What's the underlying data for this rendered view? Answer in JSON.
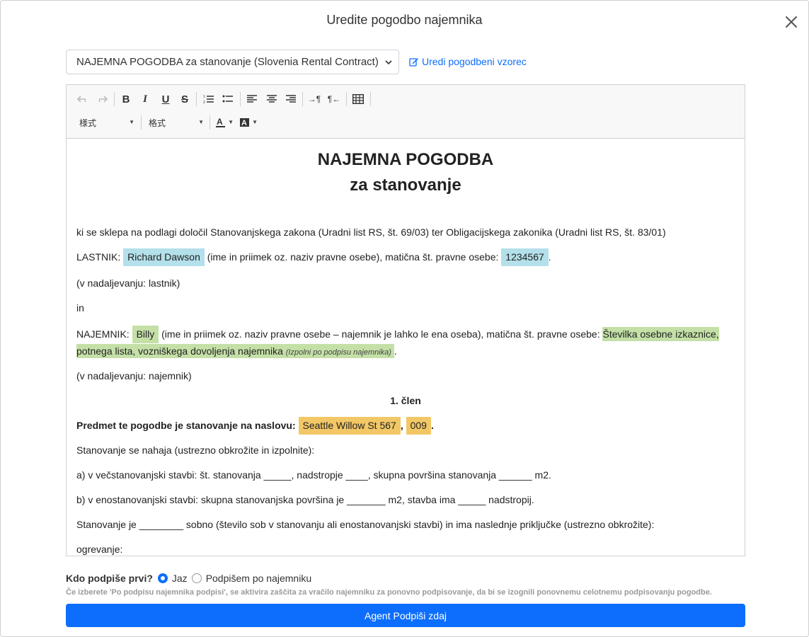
{
  "modal": {
    "title": "Uredite pogodbo najemnika"
  },
  "template": {
    "selected": "NAJEMNA POGODBA za stanovanje (Slovenia Rental Contract)",
    "edit_link": "Uredi pogodbeni vzorec"
  },
  "toolbar": {
    "style_label": "様式",
    "format_label": "格式",
    "buttons": [
      "undo",
      "redo",
      "bold",
      "italic",
      "underline",
      "strikethrough",
      "numbered-list",
      "bulleted-list",
      "align-left",
      "align-center",
      "align-right",
      "ltr",
      "rtl",
      "table",
      "text-color",
      "background-color"
    ]
  },
  "document": {
    "title_line1": "NAJEMNA POGODBA",
    "title_line2": "za stanovanje",
    "intro": "ki se sklepa na podlagi določil Stanovanjskega zakona (Uradni list RS, št. 69/03) ter Obligacijskega zakonika (Uradni list RS, št. 83/01)",
    "owner_prefix": "LASTNIK:",
    "owner_name": "Richard Dawson",
    "owner_mid": "(ime in priimek oz. naziv pravne osebe), matična št. pravne osebe:",
    "owner_id": "1234567",
    "owner_after": ".",
    "owner_note": "(v nadaljevanju: lastnik)",
    "and": "in",
    "tenant_prefix": "NAJEMNIK:",
    "tenant_name": "Billy",
    "tenant_mid": "(ime in priimek oz. naziv pravne osebe – najemnik je lahko le ena oseba), matična št. pravne osebe:",
    "tenant_id": "Številka osebne izkaznice, potnega lista, vozniškega dovoljenja najemnika",
    "tenant_id_hint": "(Izpolni po podpisu najemnika)",
    "tenant_after": ".",
    "tenant_note": "(v nadaljevanju: najemnik)",
    "article1": "1. člen",
    "subject_label": "Predmet te pogodbe je stanovanje na naslovu:",
    "address": "Seattle Willow St 567",
    "address_sep": ",",
    "unit": "009",
    "subject_after": ".",
    "located": "Stanovanje se nahaja (ustrezno obkrožite in izpolnite):",
    "option_a": "a) v večstanovanjski stavbi: št. stanovanja _____, nadstropje ____, skupna površina stanovanja ______ m2.",
    "option_b": "b) v enostanovanjski stavbi: skupna stanovanjska površina je _______ m2, stavba ima _____ nadstropij.",
    "rooms": "Stanovanje je ________ sobno (število sob v stanovanju ali enostanovanjski stavbi) in ima naslednje priključke (ustrezno obkrožite):",
    "heating": "ogrevanje:"
  },
  "signing": {
    "question": "Kdo podpiše prvi?",
    "options": [
      "Jaz",
      "Podpišem po najemniku"
    ],
    "selected": "Jaz",
    "note": "Če izberete 'Po podpisu najemnika podpisi', se aktivira zaščita za vračilo najemniku za ponovno podpisovanje, da bi se izognili ponovnemu celotnemu podpisovanju pogodbe.",
    "button": "Agent Podpiši zdaj"
  },
  "colors": {
    "primary": "#0d6efd",
    "owner_field": "#b3e0ea",
    "tenant_field": "#c4e0a7",
    "address_field": "#f2c766"
  }
}
